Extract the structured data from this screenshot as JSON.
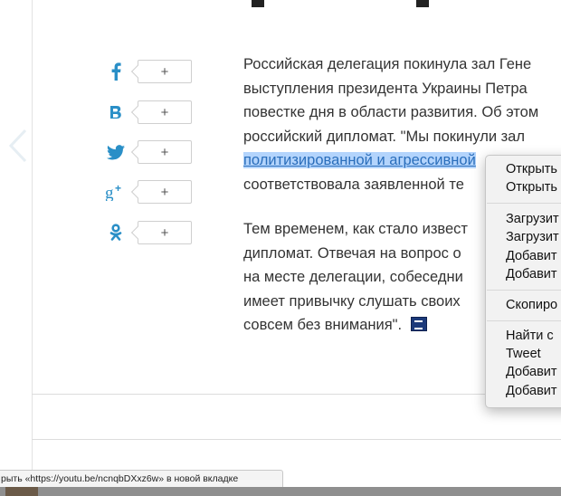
{
  "article": {
    "title_fragment": "",
    "paragraph1": {
      "line1": "Российская делегация покинула зал Гене",
      "line2": "выступления президента Украины Петра",
      "line3": "повестке дня в области развития. Об этом",
      "line4": "российский дипломат. \"Мы покинули зал",
      "line5_link": "политизированной и агрессивной",
      "line6": "соответствовала заявленной те"
    },
    "paragraph2": {
      "line1": "Тем временем, как стало извест",
      "line2": "дипломат. Отвечая на вопрос о",
      "line3": "на месте делегации, собеседни",
      "line4": "имеет привычку слушать своих",
      "line5": "совсем без внимания\"."
    },
    "source_icon": "source-logo-icon"
  },
  "share": {
    "counter_label": "+",
    "items": [
      {
        "network": "facebook",
        "icon": "facebook-icon",
        "glyph": "f",
        "count": "+"
      },
      {
        "network": "vkontakte",
        "icon": "vk-icon",
        "glyph": "B",
        "count": "+"
      },
      {
        "network": "twitter",
        "icon": "twitter-icon",
        "glyph": "",
        "count": "+"
      },
      {
        "network": "googleplus",
        "icon": "google-plus-icon",
        "glyph": "g+",
        "count": "+"
      },
      {
        "network": "odnoklassniki",
        "icon": "ok-icon",
        "glyph": "",
        "count": "+"
      }
    ],
    "icon_color": "#2a8fc7"
  },
  "context_menu": {
    "group1": [
      "Открыть",
      "Открыть"
    ],
    "group2": [
      "Загрузит",
      "Загрузит",
      "Добавит",
      "Добавит"
    ],
    "group3": [
      "Скопиро"
    ],
    "group4": [
      "Найти с",
      "Tweet",
      "Добавит",
      "Добавит"
    ]
  },
  "status_bar": {
    "text": "рыть «https://youtu.be/ncnqbDXxz6w» в новой вкладке"
  },
  "colors": {
    "selection": "#b3d4fc",
    "link": "#2a6ebb",
    "menu_bg": "#f2f2f2"
  }
}
